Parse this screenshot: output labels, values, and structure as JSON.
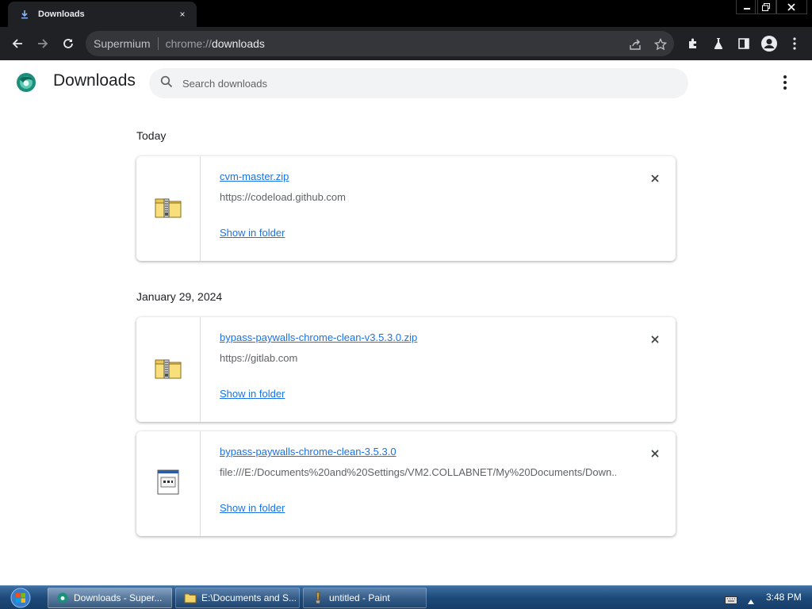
{
  "tab": {
    "title": "Downloads",
    "close": "×"
  },
  "window_controls": {
    "minimize": "—",
    "maximize": "❐",
    "close": "✕"
  },
  "omnibox": {
    "site_name": "Supermium",
    "url_scheme": "chrome://",
    "url_host": "downloads"
  },
  "header": {
    "title": "Downloads",
    "search_placeholder": "Search downloads"
  },
  "groups": [
    {
      "date": "Today",
      "items": [
        {
          "file_name": "cvm-master.zip",
          "source": "https://codeload.github.com",
          "action": "Show in folder",
          "icon": "zip-folder-icon"
        }
      ]
    },
    {
      "date": "January 29, 2024",
      "items": [
        {
          "file_name": "bypass-paywalls-chrome-clean-v3.5.3.0.zip",
          "source": "https://gitlab.com",
          "action": "Show in folder",
          "icon": "zip-folder-icon"
        },
        {
          "file_name": "bypass-paywalls-chrome-clean-3.5.3.0",
          "source": "file:///E:/Documents%20and%20Settings/VM2.COLLABNET/My%20Documents/Down...",
          "action": "Show in folder",
          "icon": "generic-file-icon"
        }
      ]
    }
  ],
  "taskbar": {
    "items": [
      {
        "label": "Downloads - Super...",
        "icon": "supermium-icon",
        "active": true
      },
      {
        "label": "E:\\Documents and S...",
        "icon": "folder-icon",
        "active": false
      },
      {
        "label": "untitled - Paint",
        "icon": "paint-icon",
        "active": false
      }
    ],
    "clock": "3:48 PM"
  },
  "colors": {
    "link": "#1a73e8",
    "toolbar": "#202124",
    "taskbar": "#1d4a7a"
  }
}
